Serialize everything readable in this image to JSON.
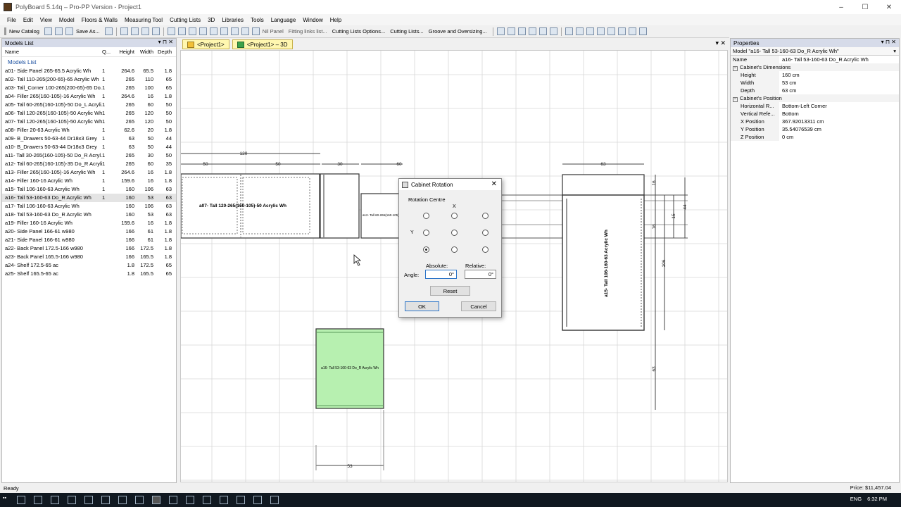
{
  "window": {
    "title": "PolyBoard 5.14q – Pro-PP Version - Project1"
  },
  "menu": [
    "File",
    "Edit",
    "View",
    "Model",
    "Floors & Walls",
    "Measuring Tool",
    "Cutting Lists",
    "3D",
    "Libraries",
    "Tools",
    "Language",
    "Window",
    "Help"
  ],
  "toolbar": {
    "new_catalog": "New Catalog",
    "save_as": "Save As...",
    "nil_panel": "Nil Panel",
    "fitting_links": "Fitting links list...",
    "cutting_options": "Cutting Lists Options...",
    "cutting_lists": "Cutting Lists...",
    "groove": "Groove and Oversizing..."
  },
  "models_panel": {
    "title": "Models List",
    "columns": {
      "name": "Name",
      "qty": "Q...",
      "height": "Height",
      "width": "Width",
      "depth": "Depth"
    },
    "group": "Models List",
    "rows": [
      {
        "name": "a01- Side Panel 265-65.5 Acrylic Wh",
        "q": "1",
        "h": "264.6",
        "w": "65.5",
        "d": "1.8"
      },
      {
        "name": "a02- Tall 110-265(200-65)-65 Acrylic Wh",
        "q": "1",
        "h": "265",
        "w": "110",
        "d": "65"
      },
      {
        "name": "a03- Tall_Corner 100-265(200-65)-65 Do...",
        "q": "1",
        "h": "265",
        "w": "100",
        "d": "65"
      },
      {
        "name": "a04- Filler 265(160-105)-16 Acrylic Wh",
        "q": "1",
        "h": "264.6",
        "w": "16",
        "d": "1.8"
      },
      {
        "name": "a05- Tall 60-265(160-105)-50 Do_L Acryli...",
        "q": "1",
        "h": "265",
        "w": "60",
        "d": "50"
      },
      {
        "name": "a06- Tall 120-265(160-105)-50 Acrylic Wh",
        "q": "1",
        "h": "265",
        "w": "120",
        "d": "50"
      },
      {
        "name": "a07- Tall 120-265(160-105)-50 Acrylic Wh",
        "q": "1",
        "h": "265",
        "w": "120",
        "d": "50"
      },
      {
        "name": "a08- Filler 20-63 Acrylic Wh",
        "q": "1",
        "h": "62.6",
        "w": "20",
        "d": "1.8"
      },
      {
        "name": "a09- B_Drawers 50-63-44 Dr18x3 Grey",
        "q": "1",
        "h": "63",
        "w": "50",
        "d": "44"
      },
      {
        "name": "a10- B_Drawers 50-63-44 Dr18x3 Grey",
        "q": "1",
        "h": "63",
        "w": "50",
        "d": "44"
      },
      {
        "name": "a11- Tall 30-265(160-105)-50 Do_R Acryl...",
        "q": "1",
        "h": "265",
        "w": "30",
        "d": "50"
      },
      {
        "name": "a12- Tall 60-265(160-105)-35 Do_R Acryli...",
        "q": "1",
        "h": "265",
        "w": "60",
        "d": "35"
      },
      {
        "name": "a13- Filler 265(160-105)-16 Acrylic Wh",
        "q": "1",
        "h": "264.6",
        "w": "16",
        "d": "1.8"
      },
      {
        "name": "a14- Filler 160-16 Acrylic Wh",
        "q": "1",
        "h": "159.6",
        "w": "16",
        "d": "1.8"
      },
      {
        "name": "a15- Tall 106-160-63 Acrylic Wh",
        "q": "1",
        "h": "160",
        "w": "106",
        "d": "63"
      },
      {
        "name": "a16- Tall 53-160-63 Do_R Acrylic Wh",
        "q": "1",
        "h": "160",
        "w": "53",
        "d": "63",
        "selected": true
      },
      {
        "name": "a17- Tall 106-160-63 Acrylic Wh",
        "q": "",
        "h": "160",
        "w": "106",
        "d": "63"
      },
      {
        "name": "a18- Tall 53-160-63 Do_R Acrylic Wh",
        "q": "",
        "h": "160",
        "w": "53",
        "d": "63"
      },
      {
        "name": "a19- Filler 160-16 Acrylic Wh",
        "q": "",
        "h": "159.6",
        "w": "16",
        "d": "1.8"
      },
      {
        "name": "a20- Side Panel 166-61 w980",
        "q": "",
        "h": "166",
        "w": "61",
        "d": "1.8"
      },
      {
        "name": "a21- Side Panel 166-61 w980",
        "q": "",
        "h": "166",
        "w": "61",
        "d": "1.8"
      },
      {
        "name": "a22- Back Panel 172.5-166 w980",
        "q": "",
        "h": "166",
        "w": "172.5",
        "d": "1.8"
      },
      {
        "name": "a23- Back Panel 165.5-166 w980",
        "q": "",
        "h": "166",
        "w": "165.5",
        "d": "1.8"
      },
      {
        "name": "a24- Shelf 172.5-65 ac",
        "q": "",
        "h": "1.8",
        "w": "172.5",
        "d": "65"
      },
      {
        "name": "a25- Shelf 165.5-65 ac",
        "q": "",
        "h": "1.8",
        "w": "165.5",
        "d": "65"
      }
    ]
  },
  "tabs": [
    "<Project1>",
    "<Project1> – 3D"
  ],
  "canvas": {
    "labels": {
      "a07": "a07- Tall 120-265(160-105)-50 Acrylic Wh",
      "a12": "a12- Tall 60-265(160-105)-35",
      "a15": "a15- Tall 106-160-63 Acrylic Wh",
      "a16": "a16- Tall 53-160-63 Do_R Acrylic Wh"
    },
    "dims": {
      "d120": "120",
      "d50a": "50",
      "d50b": "50",
      "d30": "30",
      "d60": "60",
      "d63top": "63",
      "d53": "53",
      "d106": "106",
      "d16": "16",
      "d15": "15",
      "d63v": "63",
      "d44": "44",
      "d16b": "16"
    }
  },
  "dialog": {
    "title": "Cabinet Rotation",
    "group": "Rotation Centre",
    "x_label": "X",
    "y_label": "Y",
    "absolute_label": "Absolute:",
    "relative_label": "Relative:",
    "angle_label": "Angle:",
    "absolute_value": "0°",
    "relative_value": "0°",
    "reset": "Reset",
    "ok": "OK",
    "cancel": "Cancel",
    "selected_centre": "bottom-left"
  },
  "properties": {
    "title": "Properties",
    "selector": "Model \"a16- Tall 53-160-63 Do_R Acrylic Wh\"",
    "name_key": "Name",
    "name_value": "a16- Tall 53-160-63 Do_R Acrylic Wh",
    "dims_category": "Cabinet's Dimensions",
    "height_key": "Height",
    "height_value": "160 cm",
    "width_key": "Width",
    "width_value": "53 cm",
    "depth_key": "Depth",
    "depth_value": "63 cm",
    "pos_category": "Cabinet's Position",
    "hr_key": "Horizontal R...",
    "hr_value": "Bottom-Left Corner",
    "vr_key": "Vertical Refe...",
    "vr_value": "Bottom",
    "x_key": "X Position",
    "x_value": "367.92013311 cm",
    "y_key": "Y Position",
    "y_value": "35.54076539 cm",
    "z_key": "Z Position",
    "z_value": "0 cm"
  },
  "status": {
    "text": "Ready",
    "price": "Price: $11,457.04"
  },
  "taskbar": {
    "lang": "ENG",
    "time": "6:32 PM"
  },
  "colors": {
    "selected_cabinet": "#b7f0b0",
    "grid": "#d7d7d7",
    "panel_head": "#d6dbe9"
  }
}
